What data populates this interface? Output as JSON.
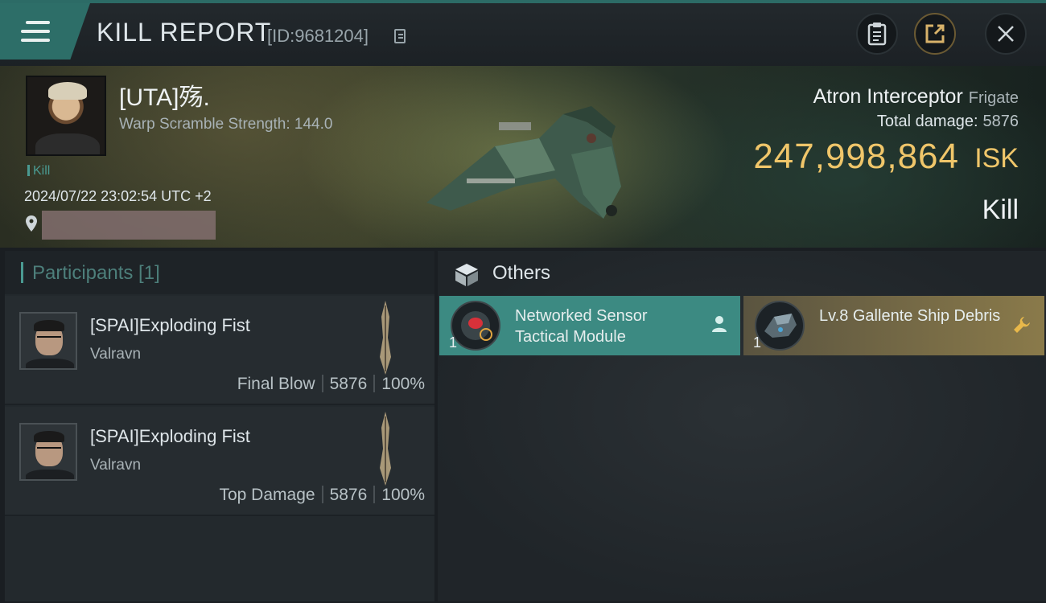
{
  "header": {
    "title": "KILL REPORT",
    "report_id": "[ID:9681204]"
  },
  "victim": {
    "name": "[UTA]殇.",
    "warp_scramble": "Warp Scramble Strength: 144.0",
    "tag": "Kill",
    "timestamp": "2024/07/22 23:02:54 UTC +2"
  },
  "ship": {
    "name": "Atron Interceptor",
    "class": "Frigate",
    "total_damage_label": "Total damage:",
    "total_damage": "5876",
    "isk_value": "247,998,864",
    "isk_unit": "ISK",
    "result": "Kill"
  },
  "participants": {
    "label": "Participants [1]",
    "rows": [
      {
        "name": "[SPAI]Exploding Fist",
        "ship": "Valravn",
        "role": "Final Blow",
        "damage": "5876",
        "percent": "100%"
      },
      {
        "name": "[SPAI]Exploding Fist",
        "ship": "Valravn",
        "role": "Top Damage",
        "damage": "5876",
        "percent": "100%"
      }
    ]
  },
  "others": {
    "label": "Others",
    "items": [
      {
        "name": "Networked Sensor Tactical Module",
        "qty": "1",
        "icon": "person-icon"
      },
      {
        "name": "Lv.8 Gallente Ship Debris",
        "qty": "1",
        "icon": "wrench-icon"
      }
    ]
  },
  "colors": {
    "accent_teal": "#3c8a82",
    "isk_gold": "#f0c66a",
    "debris_gold": "#8a7a4a"
  }
}
